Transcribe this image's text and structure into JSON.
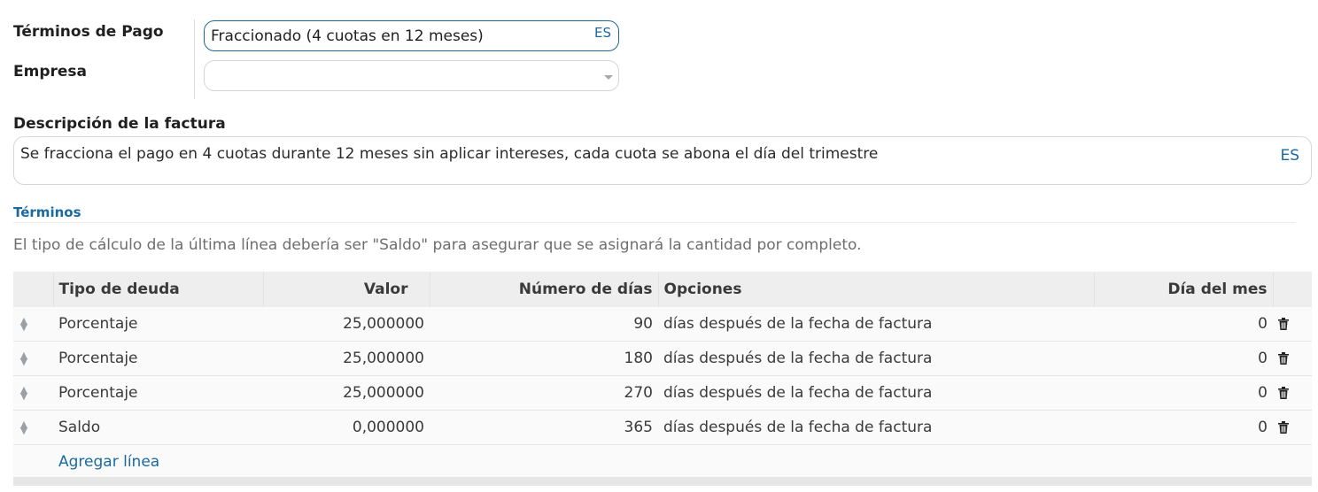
{
  "form": {
    "payment_terms_label": "Términos de Pago",
    "payment_terms_value": "Fraccionado (4 cuotas en 12 meses)",
    "payment_terms_lang": "ES",
    "company_label": "Empresa",
    "company_value": "",
    "invoice_description_label": "Descripción de la factura",
    "invoice_description_value": "Se fracciona el pago en 4 cuotas durante 12 meses sin aplicar intereses, cada cuota se abona el día del trimestre",
    "invoice_description_lang": "ES"
  },
  "terms": {
    "section_title": "Términos",
    "hint": "El tipo de cálculo de la última línea debería ser \"Saldo\" para asegurar que se asignará la cantidad por completo.",
    "columns": [
      "Tipo de deuda",
      "Valor",
      "Número de días",
      "Opciones",
      "Día del mes"
    ],
    "rows": [
      {
        "type": "Porcentaje",
        "value": "25,000000",
        "days": "90",
        "options": "días después de la fecha de factura",
        "day_of_month": "0"
      },
      {
        "type": "Porcentaje",
        "value": "25,000000",
        "days": "180",
        "options": "días después de la fecha de factura",
        "day_of_month": "0"
      },
      {
        "type": "Porcentaje",
        "value": "25,000000",
        "days": "270",
        "options": "días después de la fecha de factura",
        "day_of_month": "0"
      },
      {
        "type": "Saldo",
        "value": "0,000000",
        "days": "365",
        "options": "días después de la fecha de factura",
        "day_of_month": "0"
      }
    ],
    "add_line_label": "Agregar línea"
  },
  "icons": {
    "row_handle": "drag-handle-icon",
    "row_delete": "trash-icon",
    "select_caret": "caret-down-icon"
  }
}
